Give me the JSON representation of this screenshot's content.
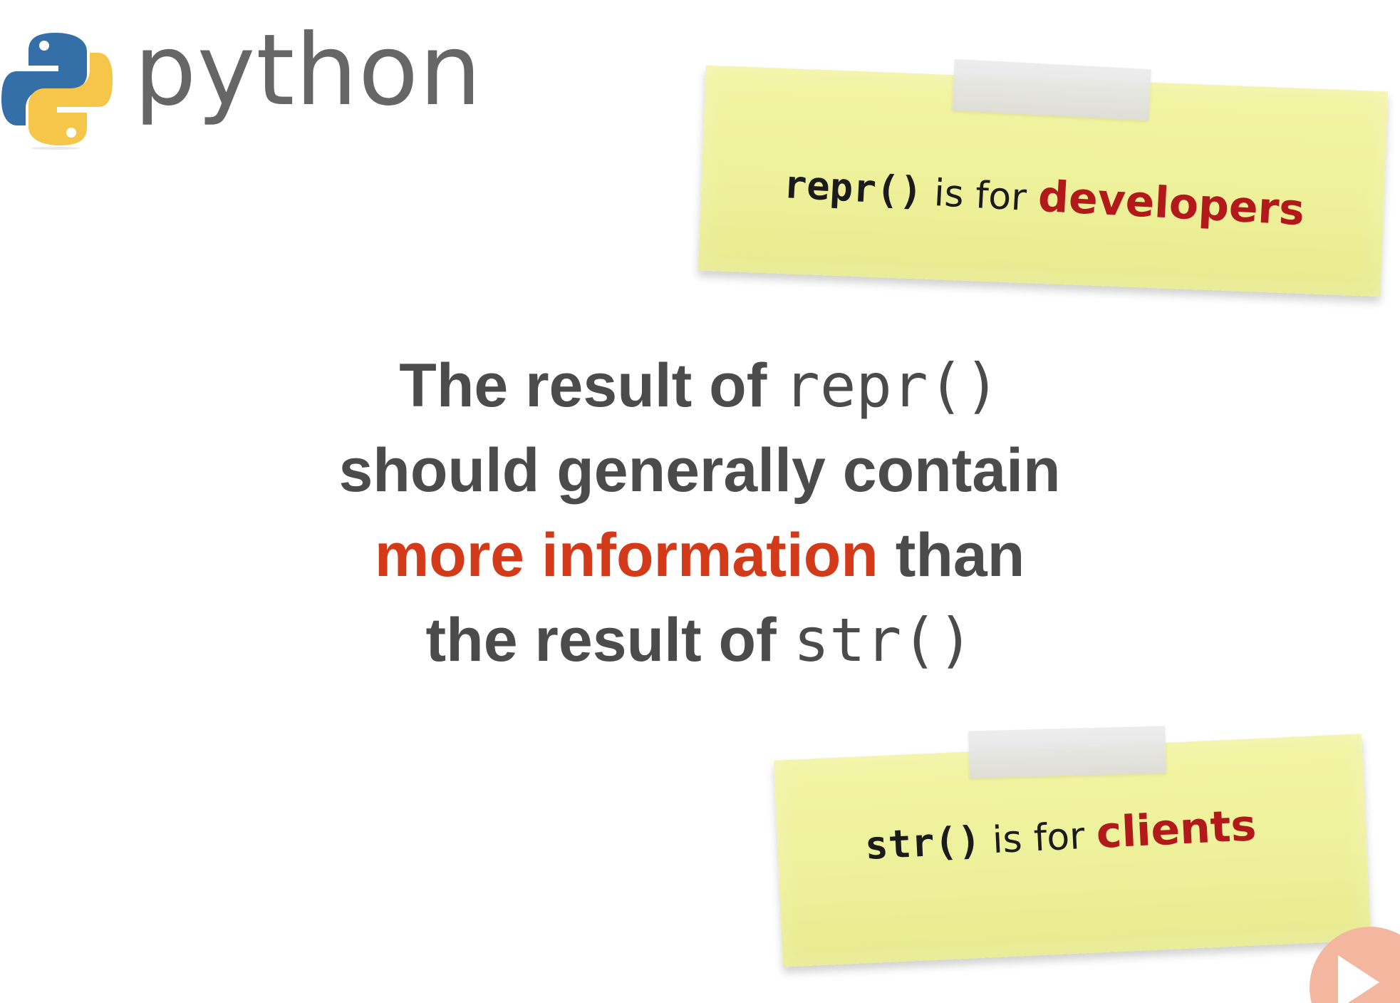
{
  "header": {
    "brand": "python",
    "logo_icon": "python-logo-icon",
    "colors": {
      "python_blue": "#356fa8",
      "python_yellow": "#f6c64a",
      "text_gray": "#666666"
    }
  },
  "statement": {
    "line1_prefix": "The result of",
    "line1_code": "repr()",
    "line2": "should generally contain",
    "line3_accent": "more information",
    "line3_suffix": "than",
    "line4_prefix": "the result of",
    "line4_code": "str()",
    "colors": {
      "text": "#4b4b4b",
      "accent": "#d33a1a"
    }
  },
  "notes": [
    {
      "code": "repr()",
      "middle": "is for",
      "emphasis": "developers",
      "colors": {
        "paper": "#f0f39f",
        "emphasis": "#b1191a"
      }
    },
    {
      "code": "str()",
      "middle": "is for",
      "emphasis": "clients",
      "colors": {
        "paper": "#f0f39f",
        "emphasis": "#b1191a"
      }
    }
  ],
  "controls": {
    "play_icon": "play-icon",
    "colors": {
      "button": "#f3b7a0",
      "icon": "#ffffff"
    }
  }
}
